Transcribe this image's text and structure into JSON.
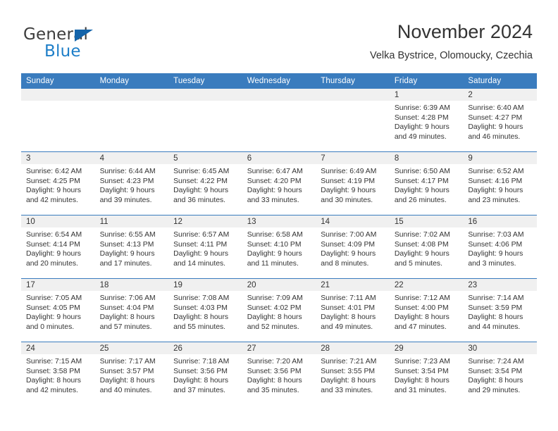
{
  "brand": {
    "name_top": "General",
    "name_bottom": "Blue",
    "accent_color": "#1d7ec8",
    "triangle_color": "#1464aa"
  },
  "header": {
    "month_title": "November 2024",
    "location": "Velka Bystrice, Olomoucky, Czechia"
  },
  "calendar": {
    "header_color": "#3a7cbe",
    "daynum_band_color": "#f0f0f0",
    "weekdays": [
      "Sunday",
      "Monday",
      "Tuesday",
      "Wednesday",
      "Thursday",
      "Friday",
      "Saturday"
    ],
    "weeks": [
      [
        {
          "day": "",
          "lines": []
        },
        {
          "day": "",
          "lines": []
        },
        {
          "day": "",
          "lines": []
        },
        {
          "day": "",
          "lines": []
        },
        {
          "day": "",
          "lines": []
        },
        {
          "day": "1",
          "lines": [
            "Sunrise: 6:39 AM",
            "Sunset: 4:28 PM",
            "Daylight: 9 hours",
            "and 49 minutes."
          ]
        },
        {
          "day": "2",
          "lines": [
            "Sunrise: 6:40 AM",
            "Sunset: 4:27 PM",
            "Daylight: 9 hours",
            "and 46 minutes."
          ]
        }
      ],
      [
        {
          "day": "3",
          "lines": [
            "Sunrise: 6:42 AM",
            "Sunset: 4:25 PM",
            "Daylight: 9 hours",
            "and 42 minutes."
          ]
        },
        {
          "day": "4",
          "lines": [
            "Sunrise: 6:44 AM",
            "Sunset: 4:23 PM",
            "Daylight: 9 hours",
            "and 39 minutes."
          ]
        },
        {
          "day": "5",
          "lines": [
            "Sunrise: 6:45 AM",
            "Sunset: 4:22 PM",
            "Daylight: 9 hours",
            "and 36 minutes."
          ]
        },
        {
          "day": "6",
          "lines": [
            "Sunrise: 6:47 AM",
            "Sunset: 4:20 PM",
            "Daylight: 9 hours",
            "and 33 minutes."
          ]
        },
        {
          "day": "7",
          "lines": [
            "Sunrise: 6:49 AM",
            "Sunset: 4:19 PM",
            "Daylight: 9 hours",
            "and 30 minutes."
          ]
        },
        {
          "day": "8",
          "lines": [
            "Sunrise: 6:50 AM",
            "Sunset: 4:17 PM",
            "Daylight: 9 hours",
            "and 26 minutes."
          ]
        },
        {
          "day": "9",
          "lines": [
            "Sunrise: 6:52 AM",
            "Sunset: 4:16 PM",
            "Daylight: 9 hours",
            "and 23 minutes."
          ]
        }
      ],
      [
        {
          "day": "10",
          "lines": [
            "Sunrise: 6:54 AM",
            "Sunset: 4:14 PM",
            "Daylight: 9 hours",
            "and 20 minutes."
          ]
        },
        {
          "day": "11",
          "lines": [
            "Sunrise: 6:55 AM",
            "Sunset: 4:13 PM",
            "Daylight: 9 hours",
            "and 17 minutes."
          ]
        },
        {
          "day": "12",
          "lines": [
            "Sunrise: 6:57 AM",
            "Sunset: 4:11 PM",
            "Daylight: 9 hours",
            "and 14 minutes."
          ]
        },
        {
          "day": "13",
          "lines": [
            "Sunrise: 6:58 AM",
            "Sunset: 4:10 PM",
            "Daylight: 9 hours",
            "and 11 minutes."
          ]
        },
        {
          "day": "14",
          "lines": [
            "Sunrise: 7:00 AM",
            "Sunset: 4:09 PM",
            "Daylight: 9 hours",
            "and 8 minutes."
          ]
        },
        {
          "day": "15",
          "lines": [
            "Sunrise: 7:02 AM",
            "Sunset: 4:08 PM",
            "Daylight: 9 hours",
            "and 5 minutes."
          ]
        },
        {
          "day": "16",
          "lines": [
            "Sunrise: 7:03 AM",
            "Sunset: 4:06 PM",
            "Daylight: 9 hours",
            "and 3 minutes."
          ]
        }
      ],
      [
        {
          "day": "17",
          "lines": [
            "Sunrise: 7:05 AM",
            "Sunset: 4:05 PM",
            "Daylight: 9 hours",
            "and 0 minutes."
          ]
        },
        {
          "day": "18",
          "lines": [
            "Sunrise: 7:06 AM",
            "Sunset: 4:04 PM",
            "Daylight: 8 hours",
            "and 57 minutes."
          ]
        },
        {
          "day": "19",
          "lines": [
            "Sunrise: 7:08 AM",
            "Sunset: 4:03 PM",
            "Daylight: 8 hours",
            "and 55 minutes."
          ]
        },
        {
          "day": "20",
          "lines": [
            "Sunrise: 7:09 AM",
            "Sunset: 4:02 PM",
            "Daylight: 8 hours",
            "and 52 minutes."
          ]
        },
        {
          "day": "21",
          "lines": [
            "Sunrise: 7:11 AM",
            "Sunset: 4:01 PM",
            "Daylight: 8 hours",
            "and 49 minutes."
          ]
        },
        {
          "day": "22",
          "lines": [
            "Sunrise: 7:12 AM",
            "Sunset: 4:00 PM",
            "Daylight: 8 hours",
            "and 47 minutes."
          ]
        },
        {
          "day": "23",
          "lines": [
            "Sunrise: 7:14 AM",
            "Sunset: 3:59 PM",
            "Daylight: 8 hours",
            "and 44 minutes."
          ]
        }
      ],
      [
        {
          "day": "24",
          "lines": [
            "Sunrise: 7:15 AM",
            "Sunset: 3:58 PM",
            "Daylight: 8 hours",
            "and 42 minutes."
          ]
        },
        {
          "day": "25",
          "lines": [
            "Sunrise: 7:17 AM",
            "Sunset: 3:57 PM",
            "Daylight: 8 hours",
            "and 40 minutes."
          ]
        },
        {
          "day": "26",
          "lines": [
            "Sunrise: 7:18 AM",
            "Sunset: 3:56 PM",
            "Daylight: 8 hours",
            "and 37 minutes."
          ]
        },
        {
          "day": "27",
          "lines": [
            "Sunrise: 7:20 AM",
            "Sunset: 3:56 PM",
            "Daylight: 8 hours",
            "and 35 minutes."
          ]
        },
        {
          "day": "28",
          "lines": [
            "Sunrise: 7:21 AM",
            "Sunset: 3:55 PM",
            "Daylight: 8 hours",
            "and 33 minutes."
          ]
        },
        {
          "day": "29",
          "lines": [
            "Sunrise: 7:23 AM",
            "Sunset: 3:54 PM",
            "Daylight: 8 hours",
            "and 31 minutes."
          ]
        },
        {
          "day": "30",
          "lines": [
            "Sunrise: 7:24 AM",
            "Sunset: 3:54 PM",
            "Daylight: 8 hours",
            "and 29 minutes."
          ]
        }
      ]
    ]
  }
}
